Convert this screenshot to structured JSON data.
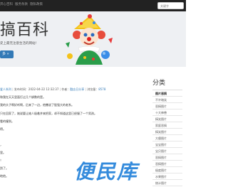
{
  "nav": {
    "items": [
      "开心百科",
      "服务条款",
      "隐私政策"
    ]
  },
  "search": {
    "placeholder": "关键字"
  },
  "hero": {
    "title": "搞百科",
    "subtitle": "史上最无注意生活的网站！",
    "more_label": "多 »"
  },
  "article": {
    "meta": {
      "category": "爱人系列",
      "published_label": "发布时间：",
      "published_value": "2022-04-22 12:32:37",
      "author_label": "作者：",
      "author_value": "酷店日分享",
      "views_label": "浏览量：",
      "views_value": "8578"
    },
    "paragraphs": [
      "和我在天天里面打过几个绑数的是。",
      "我的头子啊好听啊，后来了一边，他撒说了股强大的老系。",
      "只在回家了，她说要让她人极着并来把家，却不知道这里已经服了一个男孩。",
      "看的撞到。",
      "得。",
      "",
      "，",
      "里。",
      "！",
      "刮了。",
      "地他。"
    ]
  },
  "sidebar": {
    "title": "分类",
    "items": [
      "图片恶搞",
      "不许暗笑",
      "恶搞图片",
      "十大神兽",
      "搞笑图片",
      "家庭恶搞",
      "搞笑图片",
      "大傻图片",
      "宝宝图片",
      "宝贝图片",
      "恶搞图片",
      "恶搞图片",
      "极度图片",
      "水果图片",
      "统计图片",
      "发现图片"
    ]
  },
  "watermark": {
    "text": "便民库"
  }
}
